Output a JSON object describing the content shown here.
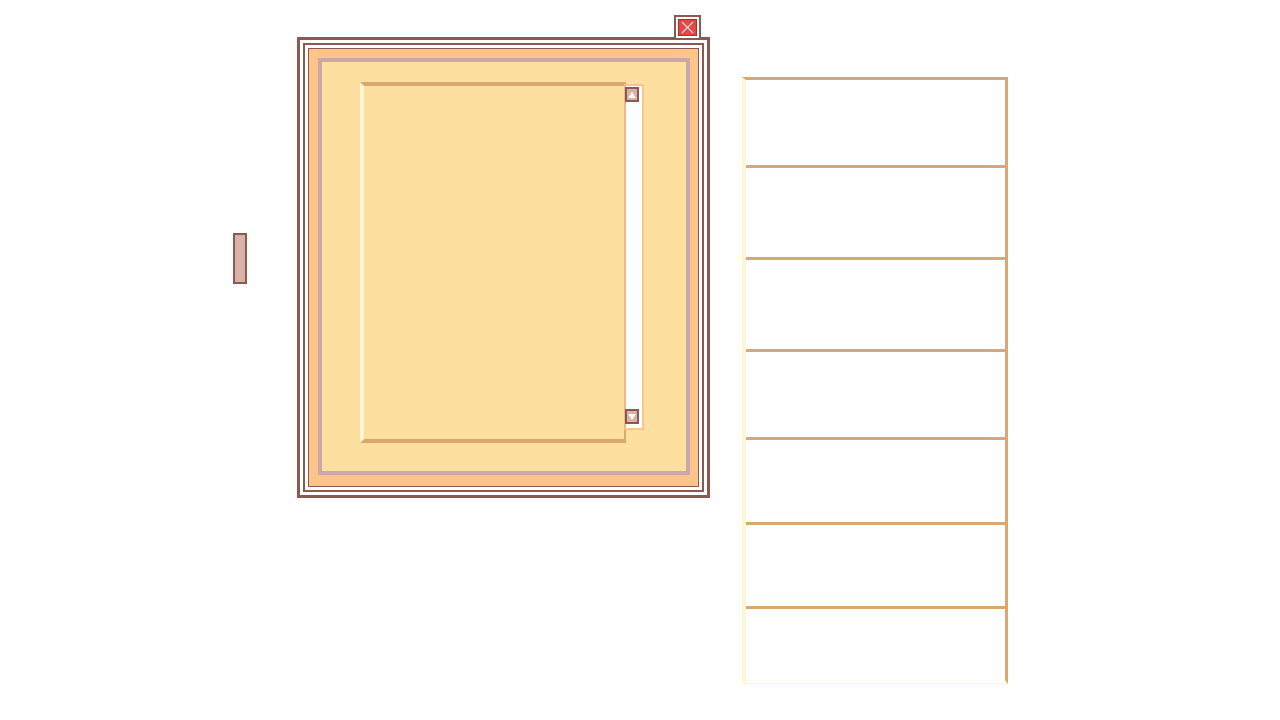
{
  "window": {
    "close_icon": "close-icon",
    "colors": {
      "frame": "#8a5a52",
      "body": "#ffc48a",
      "panel": "#fde0a0",
      "panel_border": "#c8a8a8",
      "accent_border": "#d8a870",
      "close": "#e84545"
    },
    "text_area": {
      "content": ""
    },
    "scrollbar": {
      "up_icon": "arrow-up-icon",
      "down_icon": "arrow-down-icon"
    }
  },
  "side_handle": {
    "icon": "handle-icon"
  },
  "list_panel": {
    "slots": [
      "",
      "",
      "",
      "",
      "",
      "",
      ""
    ]
  }
}
